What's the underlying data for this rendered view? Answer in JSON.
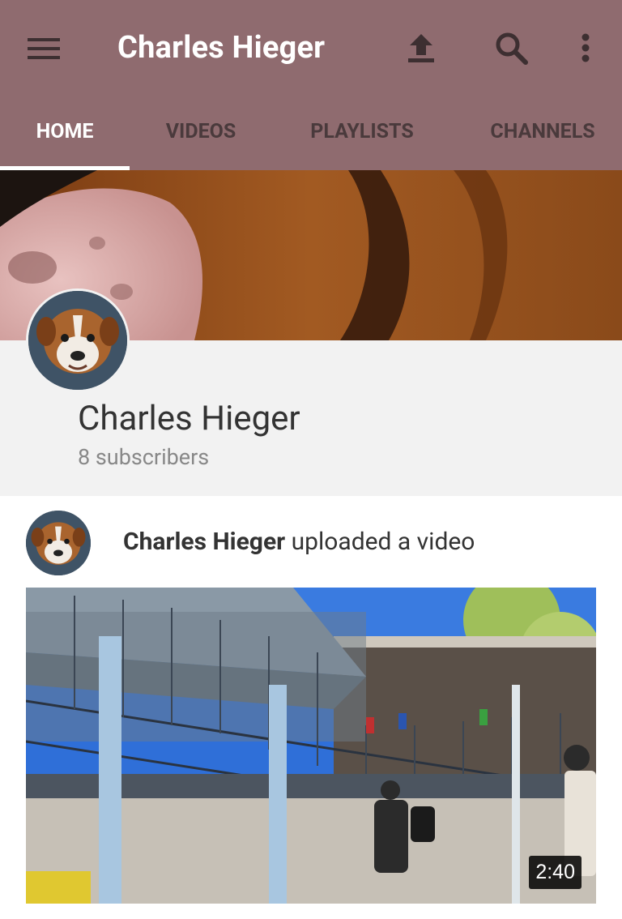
{
  "app_bar": {
    "title": "Charles Hieger",
    "icons": [
      "menu-icon",
      "upload-icon",
      "search-icon",
      "more-vert-icon"
    ]
  },
  "tabs": [
    {
      "label": "HOME",
      "active": true
    },
    {
      "label": "VIDEOS",
      "active": false
    },
    {
      "label": "PLAYLISTS",
      "active": false
    },
    {
      "label": "CHANNELS",
      "active": false
    }
  ],
  "channel": {
    "name": "Charles Hieger",
    "subscribers": "8 subscribers"
  },
  "feed": {
    "author": "Charles Hieger",
    "action": " uploaded a video",
    "video": {
      "duration": "2:40"
    }
  },
  "colors": {
    "app_bar": "#8f6b6f",
    "tab_inactive": "#4a3a3c",
    "tab_active": "#ffffff",
    "channel_info_bg": "#f2f2f2"
  }
}
